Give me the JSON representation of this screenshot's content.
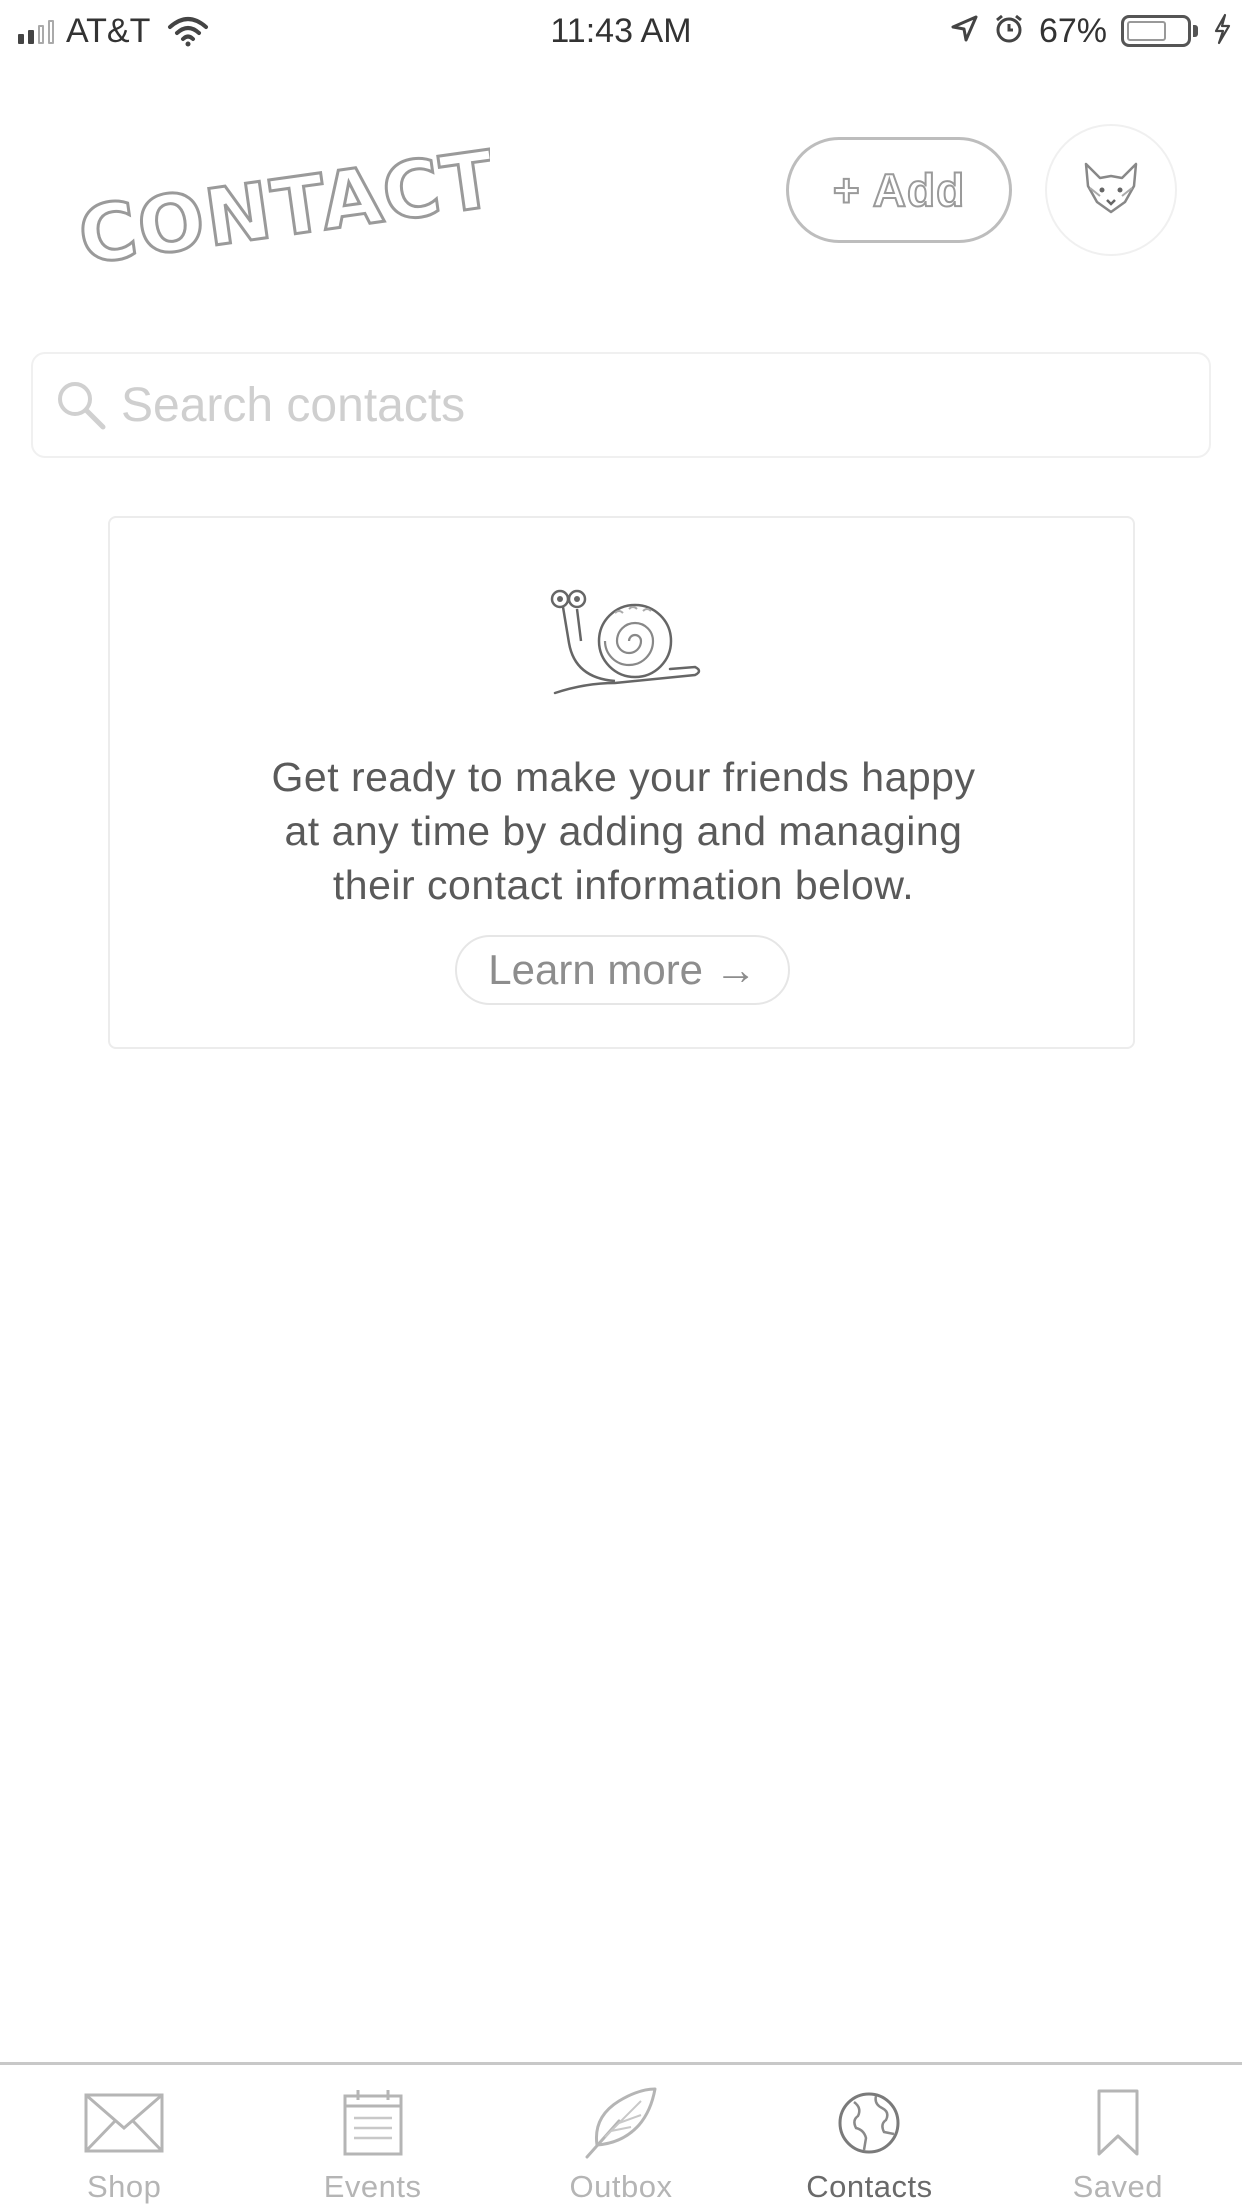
{
  "status_bar": {
    "carrier": "AT&T",
    "time": "11:43 AM",
    "battery_percent": "67%",
    "signal_bars": 2,
    "signal_bars_total": 4,
    "battery_level": 0.67
  },
  "header": {
    "title": "CONTACTS",
    "add_label": "+ Add",
    "avatar_icon": "fox-icon"
  },
  "search": {
    "placeholder": "Search contacts",
    "value": ""
  },
  "empty_state": {
    "illustration_icon": "snail-icon",
    "message_lines": [
      "Get ready to make your friends happy",
      "at any time by adding and managing",
      "their contact information below."
    ],
    "learn_more_label": "Learn more →"
  },
  "tab_bar": {
    "active_tab": "Contacts",
    "tabs": [
      {
        "label": "Shop",
        "icon": "envelope-icon"
      },
      {
        "label": "Events",
        "icon": "calendar-icon"
      },
      {
        "label": "Outbox",
        "icon": "feather-icon"
      },
      {
        "label": "Contacts",
        "icon": "globe-icon"
      },
      {
        "label": "Saved",
        "icon": "bookmark-icon"
      }
    ]
  },
  "colors": {
    "background": "#ffffff",
    "text_primary": "#5a5a5a",
    "text_muted": "#b5b5b5",
    "border": "#e6e6e6"
  }
}
